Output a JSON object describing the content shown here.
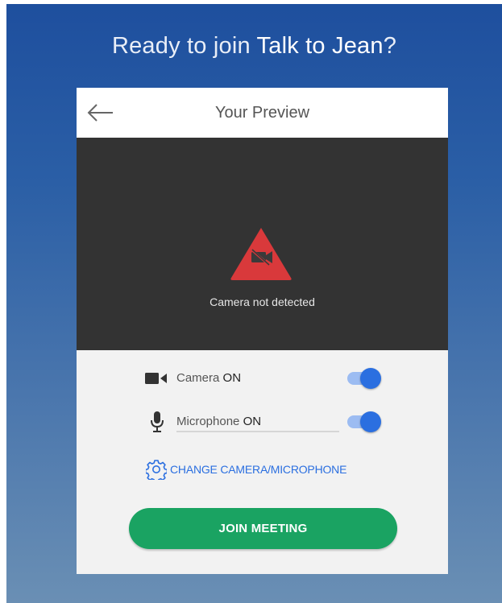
{
  "header": {
    "prefix": "Ready to join ",
    "meeting_name": "Talk to Jean",
    "suffix": "?"
  },
  "card": {
    "title": "Your Preview",
    "back_icon": "arrow-left",
    "preview": {
      "warning_icon": "camera-off-warning",
      "status": "Camera not detected"
    },
    "camera": {
      "icon": "video-camera",
      "label": "Camera",
      "state": "ON",
      "enabled": true
    },
    "microphone": {
      "icon": "microphone",
      "label": "Microphone",
      "state": "ON",
      "enabled": true
    },
    "change_device": {
      "icon": "gear",
      "label": "CHANGE CAMERA/MICROPHONE"
    },
    "join_button": {
      "label": "JOIN MEETING"
    }
  },
  "colors": {
    "background_top": "#1e4f9e",
    "background_bottom": "#6a8fb4",
    "accent_blue": "#2b6fe0",
    "join_green": "#1aa362",
    "warning_red": "#d9393b",
    "preview_dark": "#333333"
  }
}
